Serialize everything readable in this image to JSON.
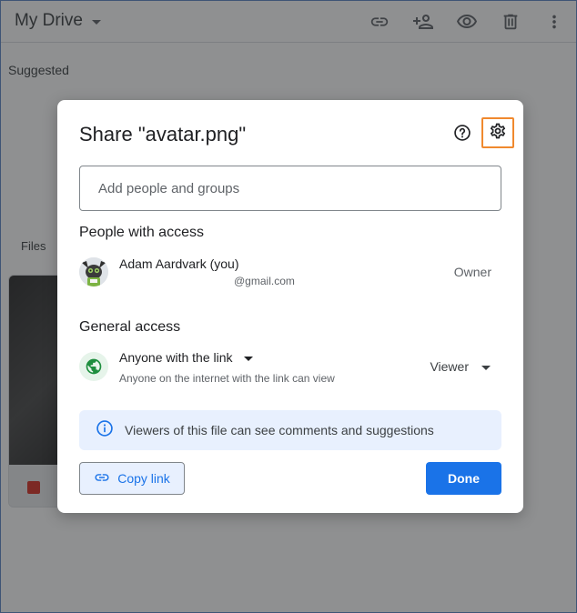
{
  "drive": {
    "title": "My Drive",
    "suggested_label": "Suggested",
    "files_label": "Files"
  },
  "dialog": {
    "title": "Share \"avatar.png\"",
    "add_placeholder": "Add people and groups",
    "people_heading": "People with access",
    "people": [
      {
        "name": "Adam Aardvark (you)",
        "email": "@gmail.com",
        "role": "Owner"
      }
    ],
    "general_heading": "General access",
    "general_access": {
      "link_setting": "Anyone with the link",
      "description": "Anyone on the internet with the link can view",
      "role": "Viewer"
    },
    "info_text": "Viewers of this file can see comments and suggestions",
    "copy_link_label": "Copy link",
    "done_label": "Done"
  },
  "colors": {
    "accent": "#1a73e8",
    "highlight": "#f0892e",
    "info_bg": "#e8f0fe",
    "globe": "#1e8e3e"
  },
  "icons": [
    "link-icon",
    "add-person-icon",
    "eye-icon",
    "trash-icon",
    "more-vert-icon",
    "help-icon",
    "gear-icon",
    "globe-icon",
    "info-icon",
    "image-icon"
  ]
}
